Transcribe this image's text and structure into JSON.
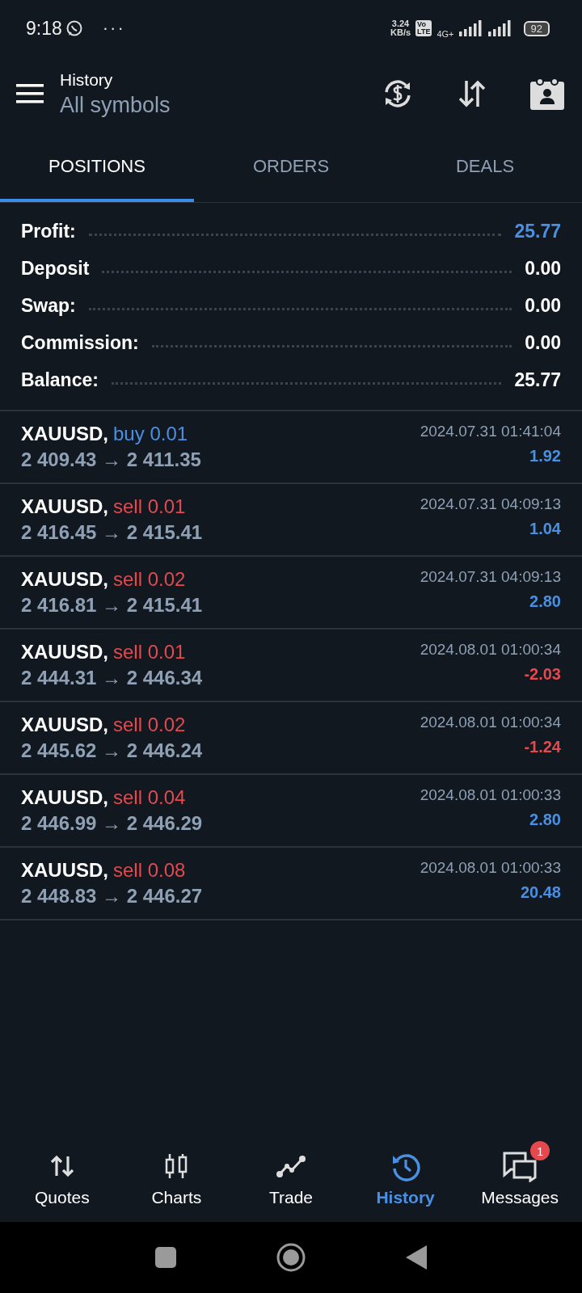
{
  "status_bar": {
    "time": "9:18",
    "more": "···",
    "speed_value": "3.24",
    "speed_unit": "KB/s",
    "volte_top": "Vo",
    "volte_bottom": "LTE",
    "network": "4G+",
    "battery": "92"
  },
  "header": {
    "title": "History",
    "subtitle": "All symbols"
  },
  "tabs": [
    {
      "label": "POSITIONS",
      "selected": true
    },
    {
      "label": "ORDERS",
      "selected": false
    },
    {
      "label": "DEALS",
      "selected": false
    }
  ],
  "summary": [
    {
      "label": "Profit:",
      "value": "25.77",
      "highlight": true
    },
    {
      "label": "Deposit",
      "value": "0.00",
      "highlight": false
    },
    {
      "label": "Swap:",
      "value": "0.00",
      "highlight": false
    },
    {
      "label": "Commission:",
      "value": "0.00",
      "highlight": false
    },
    {
      "label": "Balance:",
      "value": "25.77",
      "highlight": false
    }
  ],
  "positions": [
    {
      "symbol": "XAUUSD,",
      "side": "buy 0.01",
      "kind": "buy",
      "prices": "2 409.43 → 2 411.35",
      "time": "2024.07.31 01:41:04",
      "profit": "1.92",
      "negative": false
    },
    {
      "symbol": "XAUUSD,",
      "side": "sell 0.01",
      "kind": "sell",
      "prices": "2 416.45 → 2 415.41",
      "time": "2024.07.31 04:09:13",
      "profit": "1.04",
      "negative": false
    },
    {
      "symbol": "XAUUSD,",
      "side": "sell 0.02",
      "kind": "sell",
      "prices": "2 416.81 → 2 415.41",
      "time": "2024.07.31 04:09:13",
      "profit": "2.80",
      "negative": false
    },
    {
      "symbol": "XAUUSD,",
      "side": "sell 0.01",
      "kind": "sell",
      "prices": "2 444.31 → 2 446.34",
      "time": "2024.08.01 01:00:34",
      "profit": "-2.03",
      "negative": true
    },
    {
      "symbol": "XAUUSD,",
      "side": "sell 0.02",
      "kind": "sell",
      "prices": "2 445.62 → 2 446.24",
      "time": "2024.08.01 01:00:34",
      "profit": "-1.24",
      "negative": true
    },
    {
      "symbol": "XAUUSD,",
      "side": "sell 0.04",
      "kind": "sell",
      "prices": "2 446.99 → 2 446.29",
      "time": "2024.08.01 01:00:33",
      "profit": "2.80",
      "negative": false
    },
    {
      "symbol": "XAUUSD,",
      "side": "sell 0.08",
      "kind": "sell",
      "prices": "2 448.83 → 2 446.27",
      "time": "2024.08.01 01:00:33",
      "profit": "20.48",
      "negative": false
    }
  ],
  "bottom_nav": [
    {
      "label": "Quotes",
      "kind": "quotes",
      "selected": false
    },
    {
      "label": "Charts",
      "kind": "charts",
      "selected": false
    },
    {
      "label": "Trade",
      "kind": "trade",
      "selected": false
    },
    {
      "label": "History",
      "kind": "history",
      "selected": true
    },
    {
      "label": "Messages",
      "kind": "messages",
      "selected": false,
      "badge": "1"
    }
  ]
}
